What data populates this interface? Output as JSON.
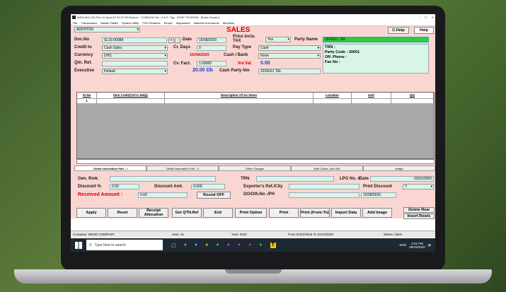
{
  "window": {
    "title": "MATLIM-5.2A) Rev:12-April-20 01:20 PM  Branch : COMMON,Tax: U.A.E.,Tag : ZONE TOURISM - [Sales Screen]",
    "menu": [
      "File",
      "Transactions",
      "Master Tables",
      "System Utility",
      "POS Features",
      "Report",
      "Adjustment",
      "Matured Documents",
      "Windows"
    ]
  },
  "form": {
    "mode": "ADDITION",
    "heading": "SALES",
    "help_btn": "C.Help",
    "help_tab": "Help",
    "doc_no_label": "Doc.No",
    "doc_no": "SL16-00088",
    "date_label": "Date",
    "date": "15/08/2020",
    "price_incl_label": "Price inclu. TAX",
    "price_incl": "Yes",
    "party_name_label": "Party Name",
    "party_name": "2226021 TEL",
    "credit_to_label": "Credit to",
    "credit_to": "Cash Sales",
    "cr_days_label": "Cr. Days",
    "cr_days": "0",
    "pay_type_label": "Pay Type",
    "pay_type": "Cash",
    "trn_label": "TRN :",
    "party_code_label": "Party Code :",
    "party_code": "20001",
    "off_phone_label": "Off. Phone :",
    "fax_label": "Fax No :",
    "currency_label": "Currency",
    "currency": "DHS",
    "date2": "15/08/2020",
    "cash_bank_label": "Cash / Bank",
    "cash_bank": "None",
    "qtn_label": "Qtn. Ref.",
    "cv_fact_label": "Cv. Fact.",
    "cv_fact": "1.00000",
    "inv_val_label": "Inv.Val.",
    "inv_val": "0.00",
    "executive_label": "Executive",
    "executive": "Default",
    "balance": "20.00 Db",
    "cash_party_label": "Cash Party Nm",
    "cash_party": "2226021 TEL"
  },
  "grid": {
    "columns": [
      "Sr.No",
      "Item Code(Ctrl+c Help)",
      "Description Of An Items",
      "Location",
      "Unit",
      "Qty"
    ],
    "rows": [
      [
        "1",
        "",
        "",
        "",
        "",
        ""
      ]
    ]
  },
  "tabs": [
    "Detail Information Part - I",
    "Detail Information Part - II",
    "Other Charges",
    "Sale Comm. and VAT",
    "Image"
  ],
  "footer": {
    "gen_rmk_label": "Gen. Rmk.",
    "trn_label": "TRN",
    "lpo_label": "LPO No. &",
    "date_label": "Date",
    "lpo_date": "02/01/2000",
    "discount_pct_label": "Discount %",
    "discount_pct": "0.00",
    "discount_amt_label": "Discount Amt.",
    "discount_amt": "0.000",
    "exporter_label": "Exporter's Ref./City",
    "print_discount_label": "Print Discount",
    "print_discount": "Y",
    "received_label": "Received Amount :",
    "received": "0.00",
    "round_off": "Round OFF",
    "do_label": "DO/Oth.No ./PH",
    "do_date": "15/08/2020"
  },
  "buttons": [
    "Apply",
    "Reset",
    "Receipt Allocation",
    "Get QTN.Ref",
    "Exit",
    "Print Option",
    "Print",
    "Print (From-To)",
    "Import Data",
    "Add Image",
    "Delete Row",
    "Insert Row/s"
  ],
  "status": {
    "company": "Company: DEMO COMPANY",
    "user": "User: sa",
    "year": "Year: 2010",
    "period": "From 01/01/2016  To 31/12/2020",
    "state": "Status: Open"
  },
  "taskbar": {
    "search_placeholder": "Type here to search",
    "lang": "ENG",
    "time": "2:01 PM",
    "date": "08/15/2020"
  }
}
